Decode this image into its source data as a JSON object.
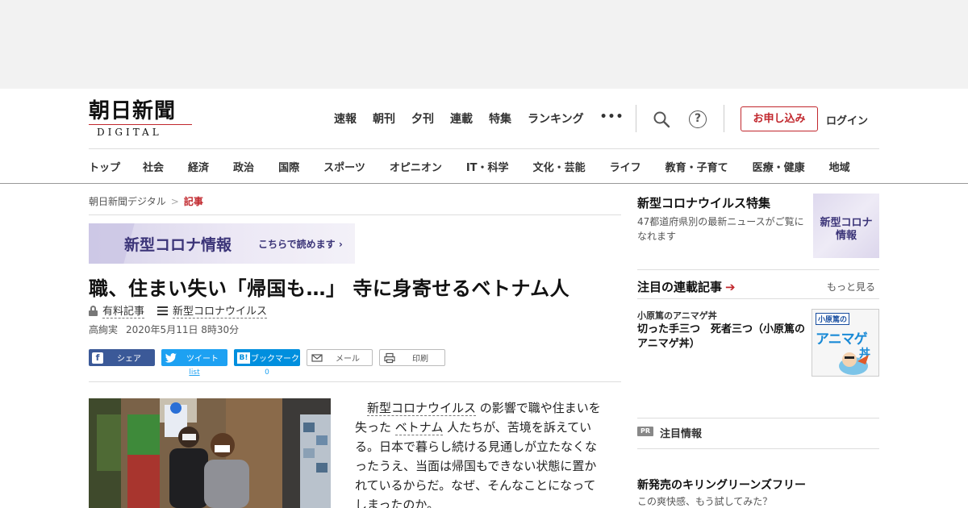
{
  "header": {
    "logo_main": "朝日新聞",
    "logo_sub": "DIGITAL",
    "top_nav": [
      "速報",
      "朝刊",
      "夕刊",
      "連載",
      "特集",
      "ランキング"
    ],
    "more_label": "•••",
    "subscribe_label": "お申し込み",
    "login_label": "ログイン",
    "help_label": "?"
  },
  "category_nav": [
    "トップ",
    "社会",
    "経済",
    "政治",
    "国際",
    "スポーツ",
    "オピニオン",
    "IT・科学",
    "文化・芸能",
    "ライフ",
    "教育・子育て",
    "医療・健康",
    "地域"
  ],
  "breadcrumb": {
    "home": "朝日新聞デジタル",
    "separator": ">",
    "current": "記事"
  },
  "banner": {
    "title": "新型コロナ情報",
    "link": "こちらで読めます ›"
  },
  "article": {
    "headline": "職、住まい失い「帰国も…」 寺に身寄せるベトナム人",
    "paid_label": "有料記事",
    "topic_label": "新型コロナウイルス",
    "author": "高絢実",
    "date": "2020年5月11日 8時30分",
    "body_kw1": "新型コロナウイルス",
    "body_part1": " の影響で職や住まいを失った ",
    "body_kw2": "ベトナム",
    "body_part2": " 人たちが、苦境を訴えている。日本で暮らし続ける見通しが立たなくなったうえ、当面は帰国もできない状態に置かれているからだ。なぜ、そんなことになってしまったのか。"
  },
  "share": {
    "facebook": "シェア",
    "twitter": "ツイート",
    "twitter_count": "list",
    "hatena_icon": "B!",
    "hatena": "ブックマーク",
    "hatena_count": "0",
    "mail": "メール",
    "print": "印刷"
  },
  "sidebar": {
    "feature_title": "新型コロナウイルス特集",
    "feature_desc": "47都道府県別の最新ニュースがご覧になれます",
    "feature_thumb_line1": "新型コロナ",
    "feature_thumb_line2": "情報",
    "serial_heading": "注目の連載記事",
    "more_label": "もっと見る",
    "serial_label": "小原篤のアニマゲ丼",
    "serial_title": "切った手三つ　死者三つ（小原篤のアニマゲ丼）",
    "serial_thumb_top": "小原篤の",
    "serial_thumb_main": "アニマゲ",
    "serial_thumb_sub": "丼",
    "pr_badge": "PR",
    "pr_label": "注目情報",
    "promo_title": "新発売のキリングリーンズフリー",
    "promo_sub": "この爽快感、もう試してみた？"
  },
  "colors": {
    "accent_red": "#c1272d",
    "banner_purple": "#3b3478",
    "facebook": "#3b5998",
    "twitter": "#1da1f2",
    "hatena": "#008fde"
  }
}
